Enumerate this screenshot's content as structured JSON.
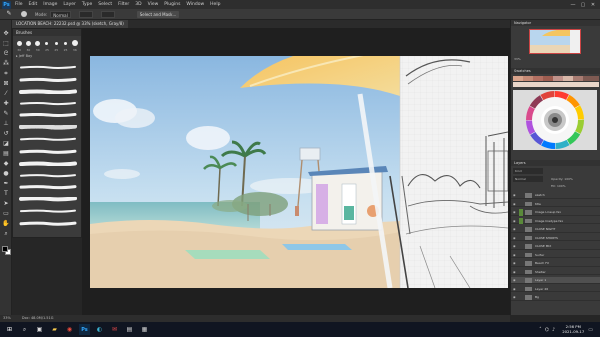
{
  "app": {
    "logo": "Ps",
    "menu": [
      "File",
      "Edit",
      "Image",
      "Layer",
      "Type",
      "Select",
      "Filter",
      "3D",
      "View",
      "Plugins",
      "Window",
      "Help"
    ],
    "window_controls": [
      "—",
      "▢",
      "✕"
    ]
  },
  "options_bar": {
    "tool_icon": "brush-icon",
    "mode_label": "Mode:",
    "mode_value": "Normal",
    "select_button": "Select and Mask..."
  },
  "document": {
    "tab_title": "LOCATION BEACH: 22232.psd @ 33% (sketch, Gray/8)"
  },
  "brushes_panel": {
    "title": "Brushes",
    "sizes": [
      "30",
      "30",
      "30",
      "25",
      "25",
      "25",
      "36",
      "25"
    ],
    "folder": "▸ Jeff Bay",
    "stroke_count": 14
  },
  "navigator": {
    "title": "Navigator",
    "zoom": "33%"
  },
  "swatches": {
    "title": "Swatches"
  },
  "layers": {
    "title": "Layers",
    "kind_label": "Kind",
    "blend_mode": "Normal",
    "opacity_label": "Opacity: 100%",
    "fill_label": "Fill: 100%",
    "items": [
      {
        "name": "sketch",
        "folder_color": ""
      },
      {
        "name": "title",
        "folder_color": ""
      },
      {
        "name": "Image Lineup fax",
        "folder_color": "#5a8a3a"
      },
      {
        "name": "Image linetype fax",
        "folder_color": "#5a8a3a"
      },
      {
        "name": "CLOSE NIGHT",
        "folder_color": ""
      },
      {
        "name": "CLOSE SHORTS",
        "folder_color": ""
      },
      {
        "name": "CLOSE MIX",
        "folder_color": ""
      },
      {
        "name": "Surfer",
        "folder_color": ""
      },
      {
        "name": "Beach FX",
        "folder_color": ""
      },
      {
        "name": "Shelter",
        "folder_color": ""
      },
      {
        "name": "Layer 1",
        "folder_color": ""
      },
      {
        "name": "Layer 26",
        "folder_color": ""
      },
      {
        "name": "Bg",
        "folder_color": ""
      }
    ]
  },
  "status_bar": {
    "zoom": "33%",
    "doc": "Doc: 48.0M/1.51G"
  },
  "taskbar": {
    "icons": [
      "windows-icon",
      "search-icon",
      "task-view-icon",
      "file-explorer-icon",
      "chrome-icon",
      "photoshop-icon",
      "edge-icon",
      "mail-icon",
      "files-icon",
      "store-icon"
    ],
    "time": "2:56 PM",
    "date": "2021-09-17"
  },
  "colors": {
    "accent": "#31a8ff",
    "panel_bg": "#3a3a3a",
    "sky": "#b6d4ee",
    "sand": "#ecd7b7"
  }
}
